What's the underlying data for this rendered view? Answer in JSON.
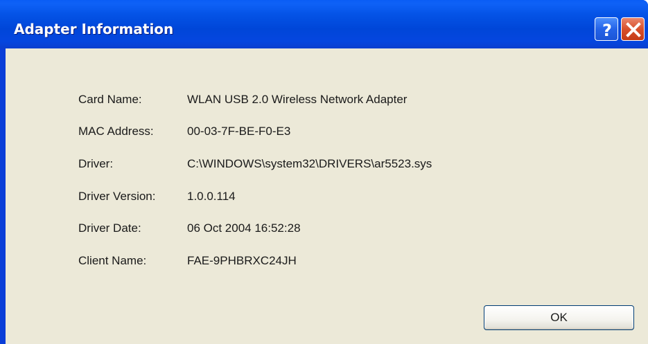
{
  "window": {
    "title": "Adapter Information",
    "help_button_label": "?",
    "close_button_icon": "close-x-icon"
  },
  "info": {
    "rows": [
      {
        "label": "Card Name:",
        "value": "WLAN USB 2.0 Wireless Network Adapter"
      },
      {
        "label": "MAC Address:",
        "value": "00-03-7F-BE-F0-E3"
      },
      {
        "label": "Driver:",
        "value": "C:\\WINDOWS\\system32\\DRIVERS\\ar5523.sys"
      },
      {
        "label": "Driver Version:",
        "value": "1.0.0.114"
      },
      {
        "label": "Driver Date:",
        "value": "06 Oct 2004 16:52:28"
      },
      {
        "label": "Client Name:",
        "value": "FAE-9PHBRXC24JH"
      }
    ]
  },
  "buttons": {
    "ok_label": "OK"
  },
  "colors": {
    "titlebar_blue": "#0453e6",
    "client_background": "#ece9d8",
    "close_red": "#d8502b",
    "help_blue": "#2463e8"
  }
}
